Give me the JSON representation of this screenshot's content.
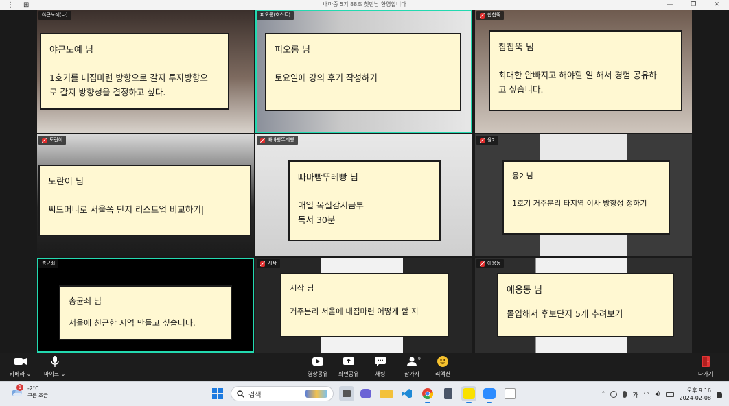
{
  "window": {
    "title": "내마중 5기 88조 첫만남 환영합니다",
    "menu_icon": "⋮",
    "layout_icon": "⊞",
    "minimize": "—",
    "restore": "❐",
    "close": "✕"
  },
  "tiles": [
    {
      "tag": "야근노예(나)",
      "muted": false,
      "active": false,
      "note_name": "야근노예 님",
      "note_text": "1호기를 내집마련 방향으로 갈지 투자방향으\n로 갈지 방향성을 결정하고 싶다."
    },
    {
      "tag": "피오롱(호스트)",
      "muted": false,
      "active": true,
      "note_name": "피오롱 님",
      "note_text": "토요일에 강의 후기 작성하기"
    },
    {
      "tag": "찹찹뚝",
      "muted": true,
      "active": false,
      "note_name": "찹찹뚝 님",
      "note_text": "최대한 안빠지고 해야할 일 해서 경험 공유하\n고 싶습니다."
    },
    {
      "tag": "도란이",
      "muted": true,
      "active": false,
      "note_name": "도란이 님",
      "note_text": "씨드머니로 서울쪽 단지 리스트업 비교하기|"
    },
    {
      "tag": "빠바빵뚜레빵",
      "muted": true,
      "active": false,
      "note_name": "빠바빵뚜레빵 님",
      "note_text": "매일 목실감시금부\n독서 30분"
    },
    {
      "tag": "융2",
      "muted": true,
      "active": false,
      "note_name": "융2 님",
      "note_text": "1호기 거주분리 타지역 이사 방향성 정하기"
    },
    {
      "tag": "총균쇠",
      "muted": false,
      "active": true,
      "note_name": "총균쇠 님",
      "note_text": "서울에 친근한 지역 만들고 싶습니다."
    },
    {
      "tag": "시작",
      "muted": true,
      "active": false,
      "note_name": "시작 님",
      "note_text": "거주분리 서울에 내집마련 어떻게 할 지"
    },
    {
      "tag": "애옹동",
      "muted": true,
      "active": false,
      "note_name": "애옹동 님",
      "note_text": "몰입해서 후보단지 5개 추려보기"
    }
  ],
  "toolbar": {
    "camera": "카메라",
    "mic": "마이크",
    "share_video": "영상공유",
    "share_screen": "화면공유",
    "chat": "채팅",
    "participants": "참가자",
    "participant_count": "9",
    "reaction": "리액션",
    "leave": "나가기",
    "caret": "⌄"
  },
  "taskbar": {
    "weather_badge": "1",
    "temperature": "-2°C",
    "weather_desc": "구름 조금",
    "search_placeholder": "검색",
    "ime": "가",
    "time": "오후 9:16",
    "date": "2024-02-08"
  },
  "colors": {
    "active_outline": "#23d9b0",
    "note_bg": "#fff8d2",
    "leave_red": "#e03434",
    "muted_red": "#e02b2b"
  }
}
